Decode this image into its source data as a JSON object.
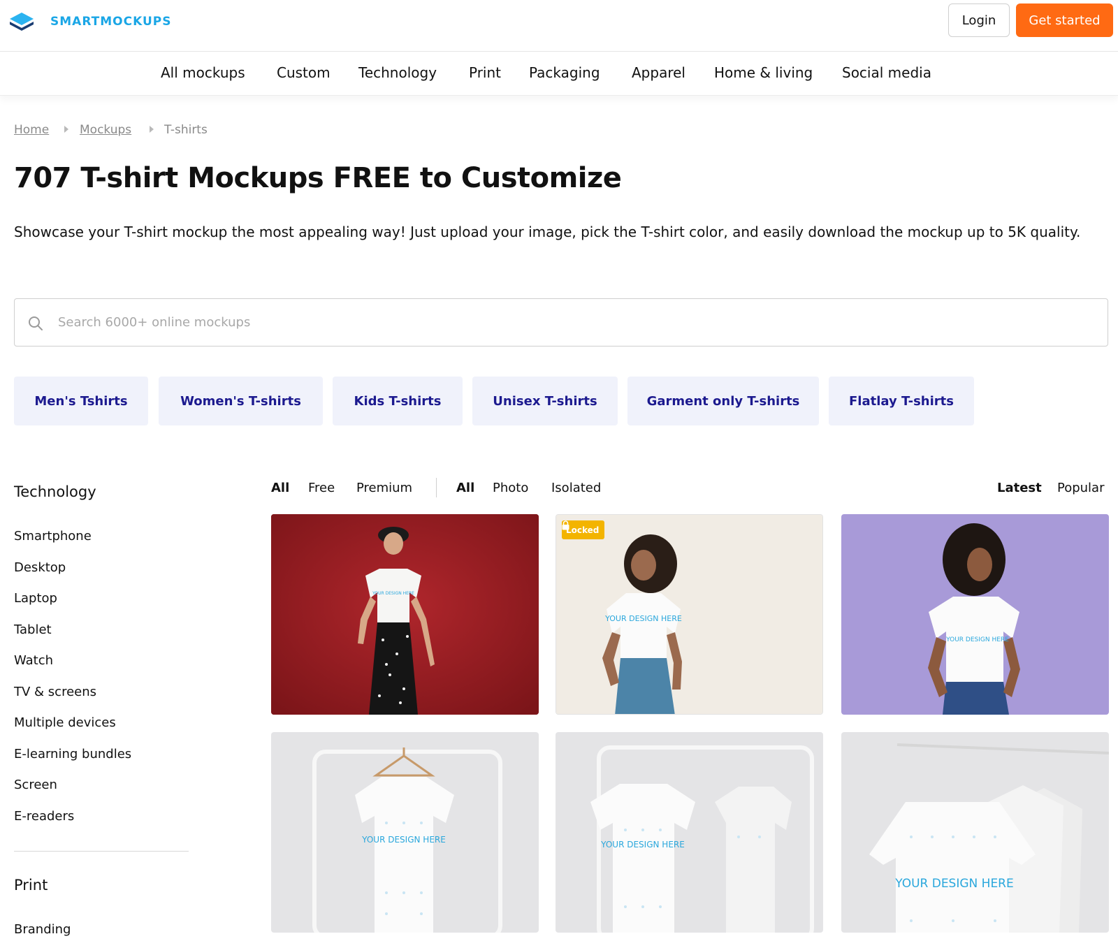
{
  "header": {
    "brand": "SMARTMOCKUPS",
    "login_label": "Login",
    "get_started_label": "Get started"
  },
  "nav": {
    "items": [
      "All mockups",
      "Custom",
      "Technology",
      "Print",
      "Packaging",
      "Apparel",
      "Home & living",
      "Social media"
    ]
  },
  "breadcrumb": {
    "home": "Home",
    "mockups": "Mockups",
    "current": "T-shirts"
  },
  "page": {
    "title": "707 T-shirt Mockups FREE to Customize",
    "description": "Showcase your T-shirt mockup the most appealing way! Just upload your image, pick the T-shirt color, and easily download the mockup up to 5K quality."
  },
  "search": {
    "placeholder": "Search 6000+ online mockups",
    "value": ""
  },
  "categories": [
    "Men's Tshirts",
    "Women's T-shirts",
    "Kids T-shirts",
    "Unisex T-shirts",
    "Garment only T-shirts",
    "Flatlay T-shirts"
  ],
  "sidebar": {
    "sections": [
      {
        "heading": "Technology",
        "items": [
          "Smartphone",
          "Desktop",
          "Laptop",
          "Tablet",
          "Watch",
          "TV & screens",
          "Multiple devices",
          "E-learning bundles",
          "Screen",
          "E-readers"
        ]
      },
      {
        "heading": "Print",
        "items": [
          "Branding"
        ]
      }
    ]
  },
  "filters": {
    "pricing": [
      "All",
      "Free",
      "Premium"
    ],
    "pricing_selected": "All",
    "type": [
      "All",
      "Photo",
      "Isolated"
    ],
    "type_selected": "All",
    "sort": [
      "Latest",
      "Popular"
    ],
    "sort_selected": "Latest"
  },
  "mockups": [
    {
      "design_text": "YOUR DESIGN HERE",
      "locked": false,
      "background": "#8f1a21"
    },
    {
      "design_text": "YOUR DESIGN HERE",
      "locked": true,
      "locked_label": "Locked",
      "background": "#f1ece4"
    },
    {
      "design_text": "YOUR DESIGN HERE",
      "locked": false,
      "background": "#a89ad8"
    },
    {
      "design_text": "YOUR DESIGN HERE",
      "locked": false,
      "background": "#e4e4e6"
    },
    {
      "design_text": "YOUR DESIGN HERE",
      "locked": false,
      "background": "#e4e4e6"
    },
    {
      "design_text": "YOUR DESIGN HERE",
      "locked": false,
      "background": "#e4e4e6"
    }
  ],
  "colors": {
    "brand": "#1aa6e6",
    "accent": "#ff6a13",
    "chip_bg": "#f0f2fb",
    "chip_text": "#1c1a8f",
    "badge": "#f3b400"
  }
}
